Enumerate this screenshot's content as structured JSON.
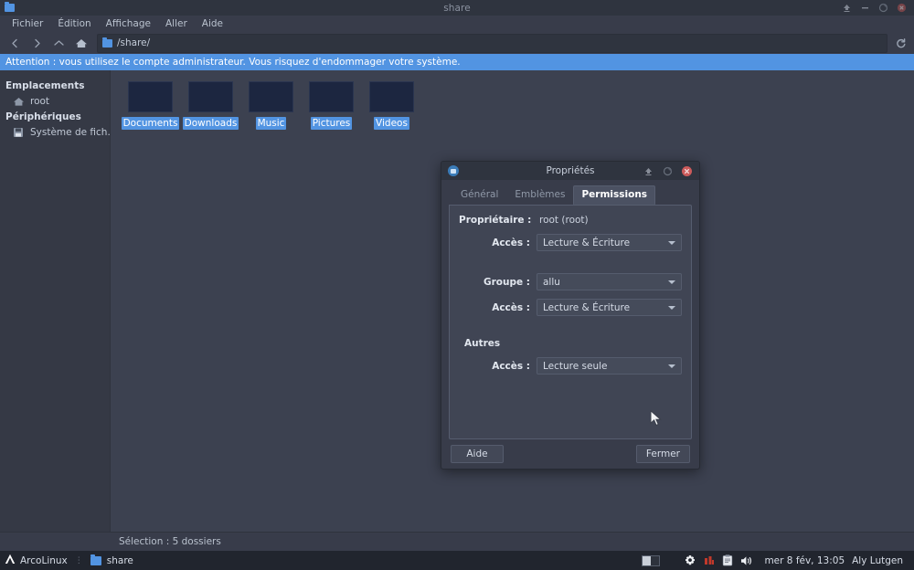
{
  "window": {
    "title": "share",
    "controls": [
      {
        "name": "shade-button",
        "icon": "shade-icon"
      },
      {
        "name": "minimize-button",
        "icon": "minimize-icon"
      },
      {
        "name": "maximize-button",
        "icon": "maximize-icon"
      },
      {
        "name": "close-button",
        "icon": "close-icon"
      }
    ]
  },
  "menubar": {
    "items": [
      {
        "label": "Fichier"
      },
      {
        "label": "Édition"
      },
      {
        "label": "Affichage"
      },
      {
        "label": "Aller"
      },
      {
        "label": "Aide"
      }
    ]
  },
  "toolbar": {
    "back": "back-icon",
    "forward": "forward-icon",
    "up": "up-icon",
    "home": "home-icon",
    "reload": "reload-icon",
    "path": "/share/"
  },
  "warning": {
    "text": "Attention : vous utilisez le compte administrateur. Vous risquez d'endommager votre système.",
    "background": "#5294e2"
  },
  "sidebar": {
    "sections": [
      {
        "title": "Emplacements",
        "items": [
          {
            "label": "root",
            "icon": "home-folder-icon"
          }
        ]
      },
      {
        "title": "Périphériques",
        "items": [
          {
            "label": "Système de fich...",
            "icon": "drive-icon"
          }
        ]
      }
    ]
  },
  "fileview": {
    "items": [
      {
        "label": "Documents",
        "selected": true
      },
      {
        "label": "Downloads",
        "selected": true
      },
      {
        "label": "Music",
        "selected": true
      },
      {
        "label": "Pictures",
        "selected": true
      },
      {
        "label": "Videos",
        "selected": true
      }
    ],
    "selection_color": "#5294e2"
  },
  "statusbar": {
    "text": "Sélection : 5 dossiers"
  },
  "dialog": {
    "title": "Propriétés",
    "controls": [
      {
        "name": "shade-button",
        "icon": "shade-icon"
      },
      {
        "name": "maximize-button",
        "icon": "maximize-icon"
      },
      {
        "name": "close-button",
        "icon": "close-icon",
        "color": "#cc5b5b"
      }
    ],
    "tabs": [
      {
        "label": "Général",
        "active": false
      },
      {
        "label": "Emblèmes",
        "active": false
      },
      {
        "label": "Permissions",
        "active": true
      }
    ],
    "permissions": {
      "owner_label": "Propriétaire :",
      "owner_value": "root (root)",
      "owner_access_label": "Accès :",
      "owner_access_value": "Lecture & Écriture",
      "group_label": "Groupe :",
      "group_value": "allu",
      "group_access_label": "Accès :",
      "group_access_value": "Lecture & Écriture",
      "others_label": "Autres",
      "others_access_label": "Accès :",
      "others_access_value": "Lecture seule"
    },
    "footer": {
      "help_label": "Aide",
      "close_label": "Fermer"
    }
  },
  "taskbar": {
    "menu_label": "ArcoLinux",
    "separator": "⋮",
    "task_label": "share",
    "tray": [
      {
        "name": "workspace-pager",
        "icon": "pager-icon"
      },
      {
        "name": "settings-icon",
        "icon": "gear-icon"
      },
      {
        "name": "network-icon",
        "icon": "network-icon"
      },
      {
        "name": "clipboard-icon",
        "icon": "clipboard-icon"
      },
      {
        "name": "volume-icon",
        "icon": "speaker-icon"
      }
    ],
    "clock": "mer  8 fév, 13:05",
    "user": "Aly Lutgen"
  }
}
